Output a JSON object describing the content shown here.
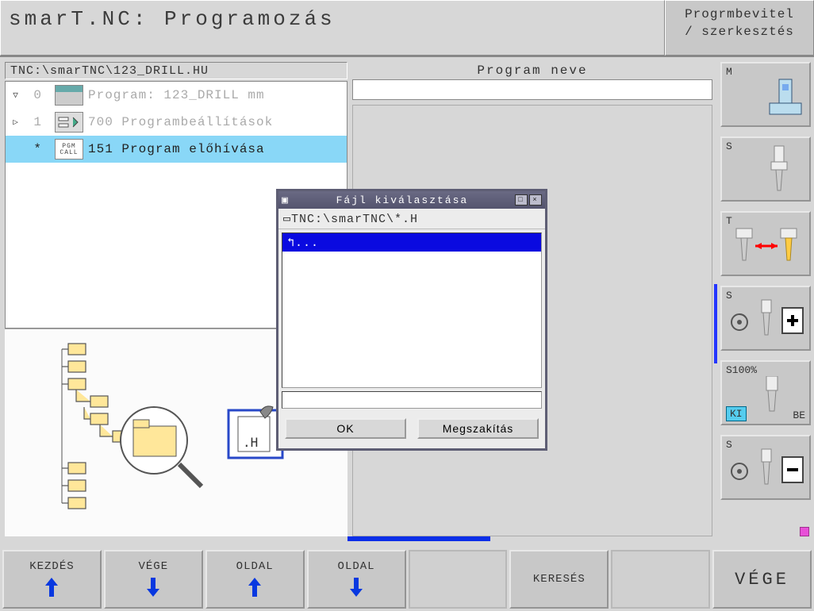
{
  "header": {
    "title": "smarT.NC: Programozás",
    "mode_line1": "Progrmbevitel",
    "mode_line2": "/ szerkesztés"
  },
  "path_bar": "TNC:\\smarTNC\\123_DRILL.HU",
  "tree": {
    "rows": [
      {
        "toggle": "▽",
        "num": "0",
        "icon": "prog",
        "label": "Program: 123_DRILL mm",
        "dim": true
      },
      {
        "toggle": "▷",
        "num": "1",
        "icon": "set",
        "label": "700 Programbeállítások",
        "dim": true
      },
      {
        "toggle": "",
        "num": "*",
        "icon": "pgmcall",
        "icon_text": "PGM\nCALL",
        "label": "151 Program előhívása",
        "sel": true
      }
    ]
  },
  "prop": {
    "header": "Program neve"
  },
  "dialog": {
    "title": "Fájl kiválasztása",
    "path": "TNC:\\smarTNC\\*.H",
    "rows": [
      "..."
    ],
    "ok": "OK",
    "cancel": "Megszakítás"
  },
  "right_buttons": [
    {
      "label": "M"
    },
    {
      "label": "S"
    },
    {
      "label": "T"
    },
    {
      "label": "S"
    },
    {
      "label": "S100%",
      "sub_left": "KI",
      "sub_right": "BE"
    },
    {
      "label": "S"
    }
  ],
  "softkeys": [
    {
      "label": "KEZDÉS",
      "arrow": "up"
    },
    {
      "label": "VÉGE",
      "arrow": "down"
    },
    {
      "label": "OLDAL",
      "arrow": "up"
    },
    {
      "label": "OLDAL",
      "arrow": "down"
    },
    {
      "blank": true
    },
    {
      "label": "KERESÉS"
    },
    {
      "blank": true
    },
    {
      "label": "VÉGE",
      "end": true
    }
  ],
  "file_ext_badge": ".H"
}
